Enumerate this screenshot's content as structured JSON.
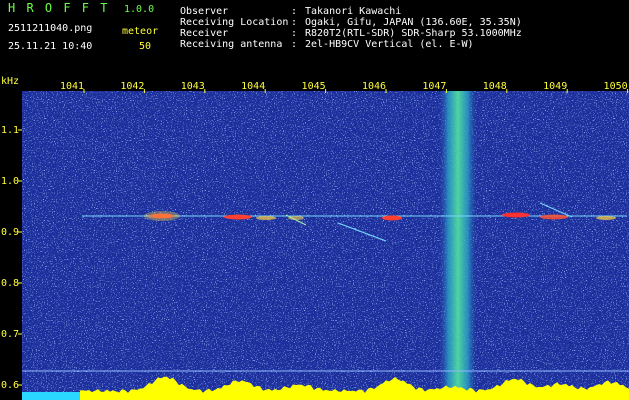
{
  "header": {
    "logo": "H R O F F T",
    "version": "1.0.0",
    "filename": "2511211040.png",
    "timestamp": "25.11.21 10:40",
    "mode_label": "meteor",
    "mode_count": "50",
    "info": [
      {
        "label": "Observer",
        "value": "Takanori Kawachi"
      },
      {
        "label": "Receiving Location",
        "value": "Ogaki, Gifu, JAPAN (136.60E, 35.35N)"
      },
      {
        "label": "Receiver",
        "value": "R820T2(RTL-SDR) SDR-Sharp 53.1000MHz"
      },
      {
        "label": "Receiving antenna",
        "value": "2el-HB9CV Vertical (el. E-W)"
      }
    ]
  },
  "spectrogram": {
    "y_unit": "kHz",
    "x_ticks": [
      "1041",
      "1042",
      "1043",
      "1044",
      "1045",
      "1046",
      "1047",
      "1048",
      "1049",
      "1050"
    ],
    "y_ticks": [
      "1.1",
      "1.0",
      "0.9",
      "0.8",
      "0.7",
      "0.6"
    ],
    "colors": {
      "background": "#1c2f9c",
      "axis_text": "#ffff3a",
      "trace": "#ffff00",
      "header_green": "#6dff48"
    }
  }
}
